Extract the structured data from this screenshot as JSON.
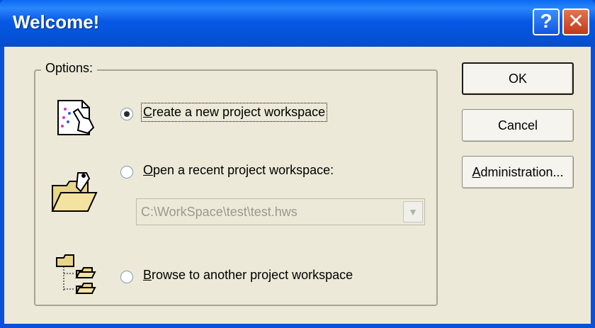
{
  "window": {
    "title": "Welcome!"
  },
  "titlebar": {
    "help": "?",
    "close": "✕"
  },
  "options": {
    "group_label": "Options:",
    "items": [
      {
        "label_underline": "C",
        "label_rest": "reate a new project workspace",
        "selected": true,
        "icon": "new-project-icon"
      },
      {
        "label_underline": "O",
        "label_rest": "pen a recent project workspace:",
        "selected": false,
        "icon": "open-folder-icon"
      },
      {
        "label_underline": "B",
        "label_rest": "rowse to another project workspace",
        "selected": false,
        "icon": "folder-tree-icon"
      }
    ],
    "recent_workspace": {
      "value": "C:\\WorkSpace\\test\\test.hws",
      "enabled": false
    }
  },
  "buttons": {
    "ok": "OK",
    "cancel": "Cancel",
    "admin_underline": "A",
    "admin_rest": "dministration..."
  },
  "colors": {
    "titlebar": "#0758e6",
    "dialog_bg": "#ece9d8",
    "close": "#c0391b"
  }
}
